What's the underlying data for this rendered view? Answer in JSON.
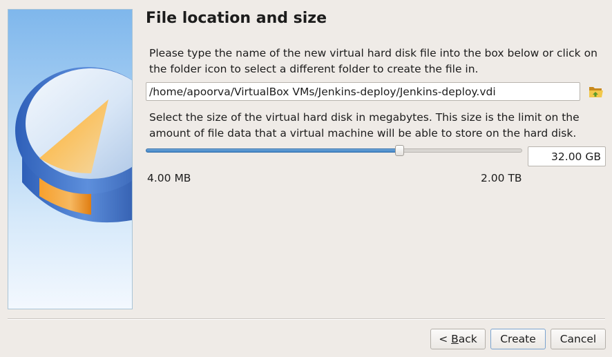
{
  "page": {
    "title": "File location and size",
    "location_description": "Please type the name of the new virtual hard disk file into the box below or click on the folder icon to select a different folder to create the file in.",
    "size_description": "Select the size of the virtual hard disk in megabytes. This size is the limit on the amount of file data that a virtual machine will be able to store on the hard disk."
  },
  "file_location": {
    "value": "/home/apoorva/VirtualBox VMs/Jenkins-deploy/Jenkins-deploy.vdi",
    "folder_icon": "folder-open-icon"
  },
  "disk_size": {
    "value": "32.00 GB",
    "min_label": "4.00 MB",
    "max_label": "2.00 TB",
    "slider_fraction": 0.676
  },
  "buttons": {
    "back_prefix": "< ",
    "back_mnemonic": "B",
    "back_rest": "ack",
    "create": "Create",
    "cancel": "Cancel"
  },
  "colors": {
    "accent": "#3f84c6",
    "background": "#efebe7"
  }
}
